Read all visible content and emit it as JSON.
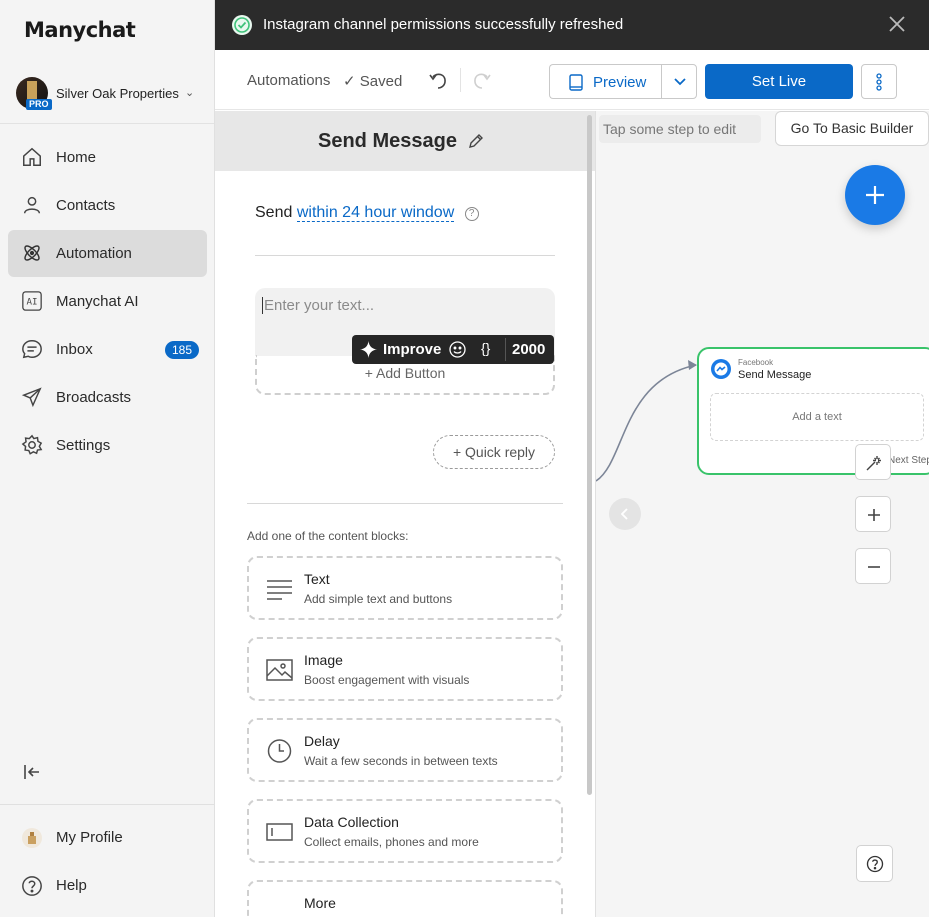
{
  "brand": {
    "logo": "Manychat",
    "accent": "#0a69c7"
  },
  "account": {
    "name": "Silver Oak Properties",
    "badge": "PRO"
  },
  "nav": [
    {
      "label": "Home",
      "icon": "home-icon"
    },
    {
      "label": "Contacts",
      "icon": "person-icon"
    },
    {
      "label": "Automation",
      "icon": "atom-icon",
      "active": true
    },
    {
      "label": "Manychat AI",
      "icon": "ai-icon"
    },
    {
      "label": "Inbox",
      "icon": "chat-icon",
      "badge": "185"
    },
    {
      "label": "Broadcasts",
      "icon": "send-icon"
    },
    {
      "label": "Settings",
      "icon": "gear-icon"
    }
  ],
  "bottom_nav": [
    {
      "label": "My Profile",
      "icon": "profile-avatar"
    },
    {
      "label": "Help",
      "icon": "help-icon"
    }
  ],
  "toast": {
    "text": "Instagram channel permissions successfully refreshed",
    "status_color": "#3fc27a"
  },
  "toolbar": {
    "automations": "Automations",
    "saved": "Saved",
    "preview": "Preview",
    "set_live": "Set Live"
  },
  "panel": {
    "title": "Send Message",
    "send_prefix": "Send",
    "send_window": "within 24 hour window",
    "help": "?",
    "placeholder": "Enter your text...",
    "ai_improve": "Improve",
    "ai_var": "{}",
    "char_limit": "2000",
    "add_button": "+ Add Button",
    "quick_reply": "+ Quick reply",
    "blocks_title": "Add one of the content blocks:",
    "blocks": [
      {
        "title": "Text",
        "subtitle": "Add simple text and buttons",
        "icon": "text-lines-icon"
      },
      {
        "title": "Image",
        "subtitle": "Boost engagement with visuals",
        "icon": "image-icon"
      },
      {
        "title": "Delay",
        "subtitle": "Wait a few seconds in between texts",
        "icon": "clock-icon"
      },
      {
        "title": "Data Collection",
        "subtitle": "Collect emails, phones and more",
        "icon": "input-field-icon"
      },
      {
        "title": "More",
        "subtitle": "",
        "icon": "more-dots-icon"
      }
    ]
  },
  "canvas": {
    "hint": "Tap some step to edit",
    "basic_builder": "Go To Basic Builder",
    "node": {
      "channel": "Facebook",
      "title": "Send Message",
      "add_text": "Add a text",
      "next_step": "Next Step"
    }
  }
}
